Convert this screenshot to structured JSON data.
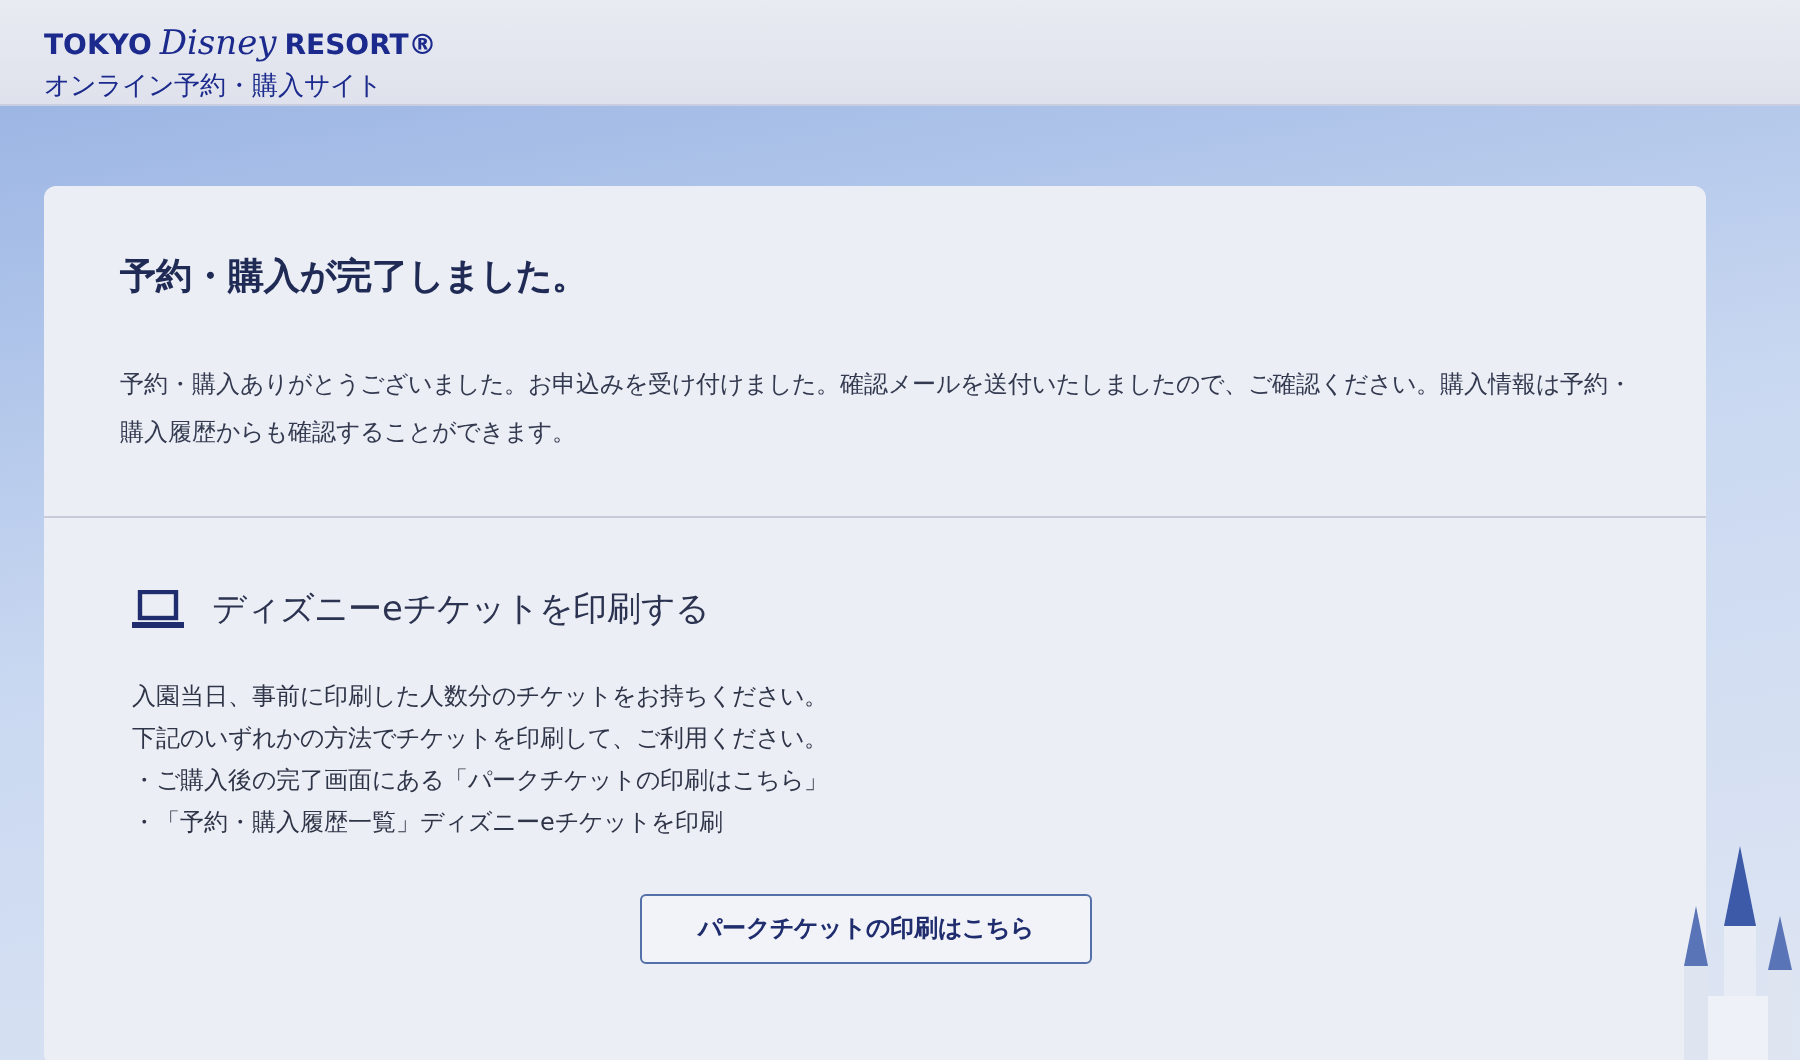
{
  "header": {
    "logo": {
      "brand_left": "TOKYO",
      "brand_script": "Disney",
      "brand_right": "RESORT®"
    },
    "subtitle": "オンライン予約・購入サイト"
  },
  "card": {
    "title": "予約・購入が完了しました。",
    "message": "予約・購入ありがとうございました。お申込みを受け付けました。確認メールを送付いたしましたので、ご確認ください。購入情報は予約・購入履歴からも確認することができます。",
    "print_section": {
      "heading": "ディズニーeチケットを印刷する",
      "lines": [
        "入園当日、事前に印刷した人数分のチケットをお持ちください。",
        "下記のいずれかの方法でチケットを印刷して、ご利用ください。",
        "・ご購入後の完了画面にある「パークチケットの印刷はこちら」",
        "・「予約・購入履歴一覧」ディズニーeチケットを印刷"
      ],
      "button": "パークチケットの印刷はこちら"
    }
  }
}
